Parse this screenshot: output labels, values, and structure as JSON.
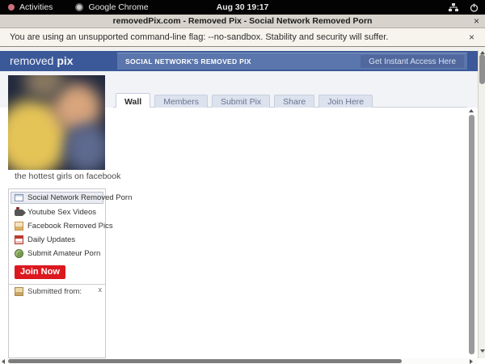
{
  "system_bar": {
    "activities": "Activities",
    "app": "Google Chrome",
    "clock": "Aug 30  19:17"
  },
  "browser": {
    "tab_title": "removedPix.com - Removed Pix - Social Network Removed Porn",
    "tab_close": "×",
    "infobar_message": "You are using an unsupported command-line flag: --no-sandbox. Stability and security will suffer.",
    "infobar_close": "×"
  },
  "header": {
    "logo_part1": "removed ",
    "logo_part2": "pix",
    "navbar_title": "SOCIAL NETWORK'S REMOVED PIX",
    "access_link": "Get Instant Access Here"
  },
  "tabs": {
    "wall": "Wall",
    "members": "Members",
    "submit_pix": "Submit Pix",
    "share": "Share",
    "join_here": "Join Here"
  },
  "sidebar": {
    "photo_caption": "the hottest girls on facebook",
    "menu": [
      {
        "label": "Social Network Removed Porn",
        "icon": "list-icon"
      },
      {
        "label": "Youtube Sex Videos",
        "icon": "video-camera-icon"
      },
      {
        "label": "Facebook Removed Pics",
        "icon": "picture-icon"
      },
      {
        "label": "Daily Updates",
        "icon": "calendar-icon"
      },
      {
        "label": "Submit Amateur Porn",
        "icon": "globe-icon"
      }
    ],
    "join_button": "Join Now",
    "submitted_label": "Submitted from:",
    "submitted_close": "x"
  },
  "colors": {
    "header_blue": "#3b5998",
    "navbar_blue": "#5b76ac",
    "join_red": "#dc181f",
    "active_item_bg": "#e9ebf1",
    "infobar_bg": "#f7f4ed",
    "titlebar_bg": "#d7d3cc"
  }
}
